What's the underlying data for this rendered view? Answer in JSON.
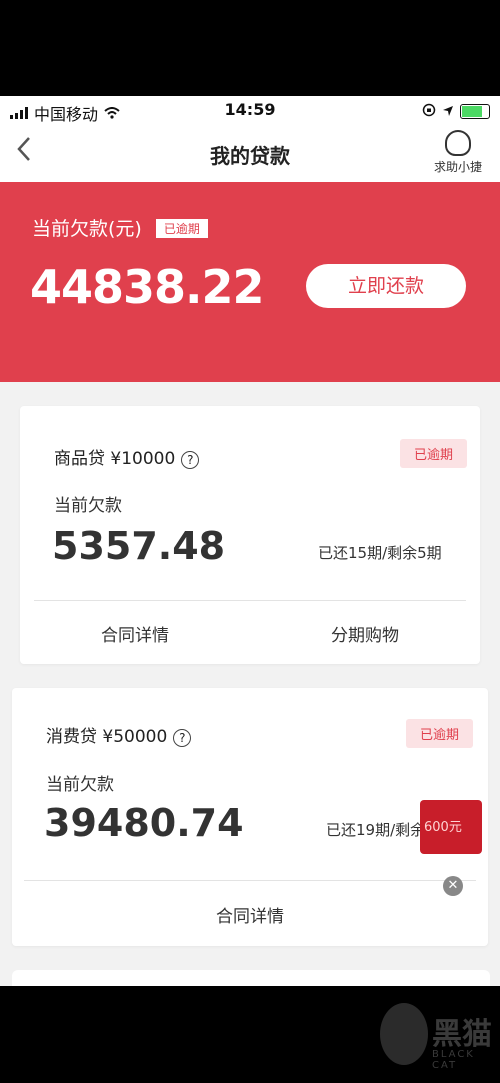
{
  "status_bar": {
    "carrier": "中国移动",
    "time": "14:59"
  },
  "nav": {
    "title": "我的贷款",
    "help_label": "求助小捷"
  },
  "summary": {
    "label": "当前欠款(元)",
    "tag": "已逾期",
    "amount": "44838.22",
    "repay_button": "立即还款"
  },
  "loans": [
    {
      "title": "商品贷 ¥10000",
      "status": "已逾期",
      "debt_label": "当前欠款",
      "amount": "5357.48",
      "periods": "已还15期/剩余5期",
      "link_contract": "合同详情",
      "link_installment": "分期购物"
    },
    {
      "title": "消费贷 ¥50000",
      "status": "已逾期",
      "debt_label": "当前欠款",
      "amount": "39480.74",
      "periods": "已还19期/剩余",
      "link_contract": "合同详情"
    }
  ],
  "promo": {
    "text": "600元"
  },
  "watermark": {
    "name": "黑猫",
    "sub": "BLACK CAT"
  },
  "colors": {
    "accent": "#e0404d",
    "tag_bg": "#fbe2e4"
  }
}
